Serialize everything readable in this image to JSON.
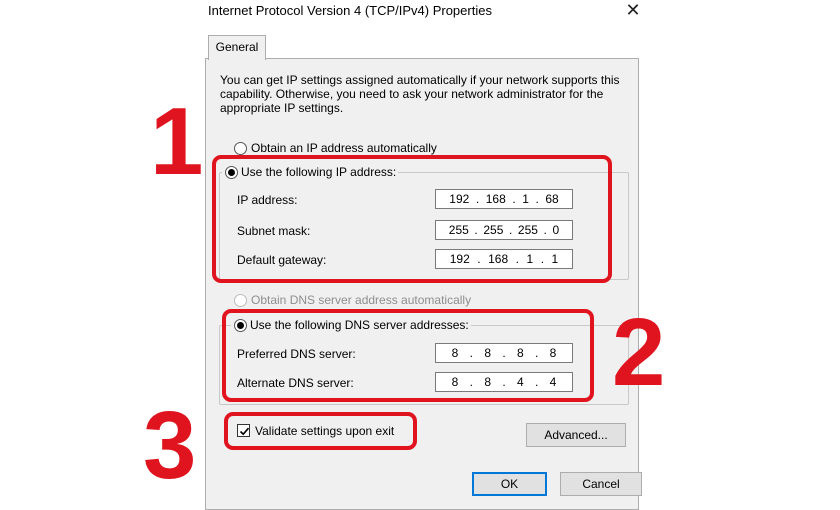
{
  "dialog": {
    "title": "Internet Protocol Version 4 (TCP/IPv4) Properties",
    "close_glyph": "✕",
    "tab_general": "General",
    "description": "You can get IP settings assigned automatically if your network supports this capability. Otherwise, you need to ask your network administrator for the appropriate IP settings."
  },
  "ip": {
    "auto_label": "Obtain an IP address automatically",
    "manual_label": "Use the following IP address:",
    "auto_selected": false,
    "manual_selected": true,
    "fields": [
      {
        "label": "IP address:",
        "octets": [
          "192",
          "168",
          "1",
          "68"
        ]
      },
      {
        "label": "Subnet mask:",
        "octets": [
          "255",
          "255",
          "255",
          "0"
        ]
      },
      {
        "label": "Default gateway:",
        "octets": [
          "192",
          "168",
          "1",
          "1"
        ]
      }
    ]
  },
  "dns": {
    "auto_label": "Obtain DNS server address automatically",
    "auto_disabled": true,
    "manual_label": "Use the following DNS server addresses:",
    "manual_selected": true,
    "fields": [
      {
        "label": "Preferred DNS server:",
        "octets": [
          "8",
          "8",
          "8",
          "8"
        ]
      },
      {
        "label": "Alternate DNS server:",
        "octets": [
          "8",
          "8",
          "4",
          "4"
        ]
      }
    ]
  },
  "validate": {
    "label": "Validate settings upon exit",
    "checked": true
  },
  "buttons": {
    "advanced": "Advanced...",
    "ok": "OK",
    "cancel": "Cancel"
  },
  "annotations": {
    "step1": "1",
    "step2": "2",
    "step3": "3",
    "color": "#e0141f"
  }
}
